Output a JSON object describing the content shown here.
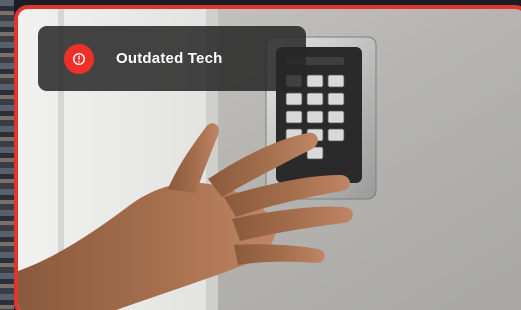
{
  "notification": {
    "icon": "alert-circle-icon",
    "label": "Outdated Tech",
    "icon_color": "#ef2f2a"
  },
  "frame": {
    "border_color": "#e0342c"
  },
  "image": {
    "subject": "hand-touching-keypad"
  }
}
